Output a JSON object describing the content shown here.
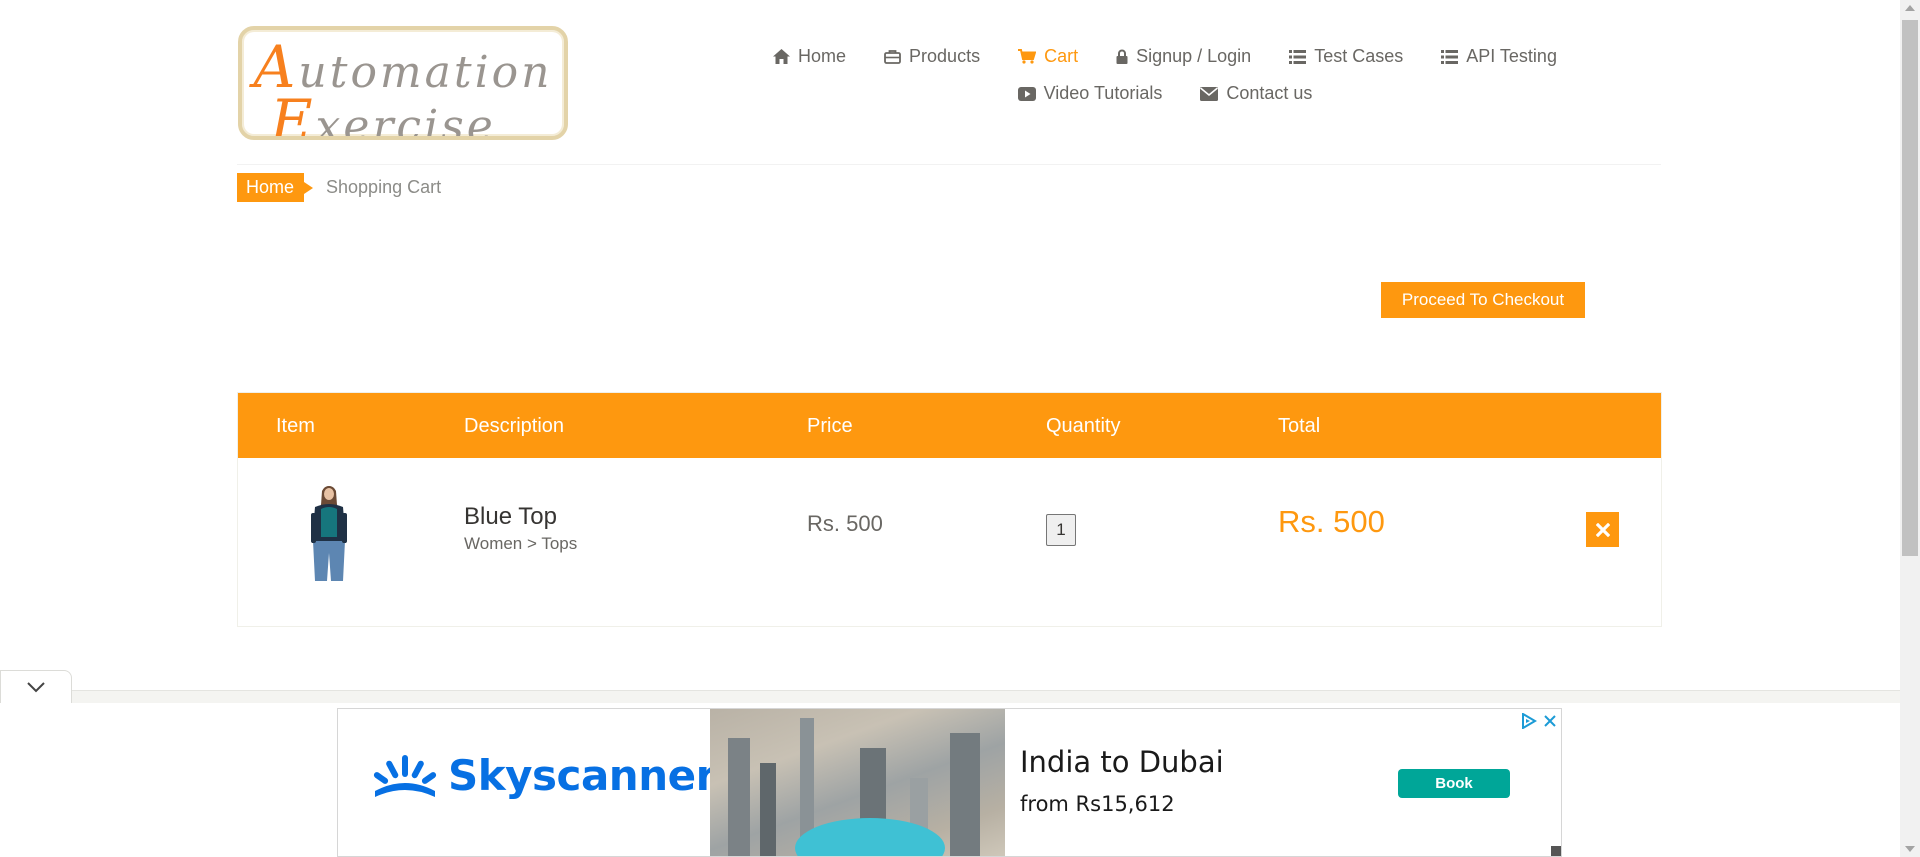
{
  "logo": {
    "line1": "Automation",
    "line2": "Exercise"
  },
  "nav": {
    "row1": [
      {
        "label": "Home",
        "icon": "home-icon"
      },
      {
        "label": "Products",
        "icon": "briefcase-icon"
      },
      {
        "label": "Cart",
        "icon": "shopping-cart-icon",
        "active": true
      },
      {
        "label": "Signup / Login",
        "icon": "lock-icon"
      },
      {
        "label": "Test Cases",
        "icon": "list-icon"
      },
      {
        "label": "API Testing",
        "icon": "list-icon"
      }
    ],
    "row2": [
      {
        "label": "Video Tutorials",
        "icon": "youtube-play-icon"
      },
      {
        "label": "Contact us",
        "icon": "envelope-icon"
      }
    ]
  },
  "breadcrumb": {
    "home": "Home",
    "current": "Shopping Cart"
  },
  "checkout": {
    "label": "Proceed To Checkout"
  },
  "cart": {
    "columns": [
      "Item",
      "Description",
      "Price",
      "Quantity",
      "Total"
    ],
    "rows": [
      {
        "name": "Blue Top",
        "category": "Women > Tops",
        "price": "Rs. 500",
        "quantity": "1",
        "total": "Rs. 500",
        "delete_icon": "close-icon"
      }
    ]
  },
  "ad": {
    "brand": "Skyscanner",
    "title": "India to Dubai",
    "subtitle": "from Rs15,612",
    "button": "Book"
  },
  "colors": {
    "accent": "#fe980f",
    "text": "#696763",
    "skyscanner_blue": "#0770e3",
    "book_button": "#00a698"
  }
}
